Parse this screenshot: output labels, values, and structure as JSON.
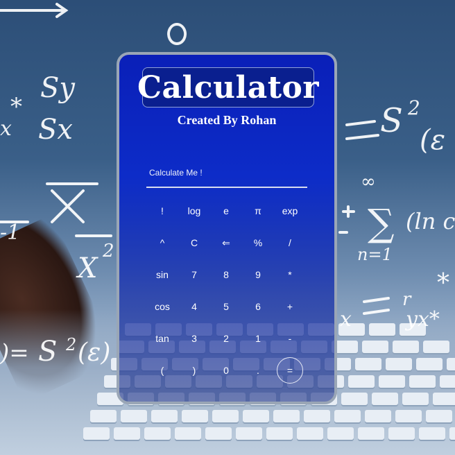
{
  "app": {
    "title": "Calculator",
    "subtitle": "Created By Rohan"
  },
  "display": {
    "placeholder": "Calculate Me !",
    "value": ""
  },
  "keys": [
    [
      "!",
      "log",
      "e",
      "π",
      "exp"
    ],
    [
      "^",
      "C",
      "⇐",
      "%",
      "/"
    ],
    [
      "sin",
      "7",
      "8",
      "9",
      "*"
    ],
    [
      "cos",
      "4",
      "5",
      "6",
      "+"
    ],
    [
      "tan",
      "3",
      "2",
      "1",
      "-"
    ],
    [
      "(",
      ")",
      "0",
      ".",
      "="
    ]
  ],
  "colors": {
    "card_top": "#0a1fb8",
    "card_border": "#9aa6b6",
    "title_box": "#0a1f8f"
  }
}
